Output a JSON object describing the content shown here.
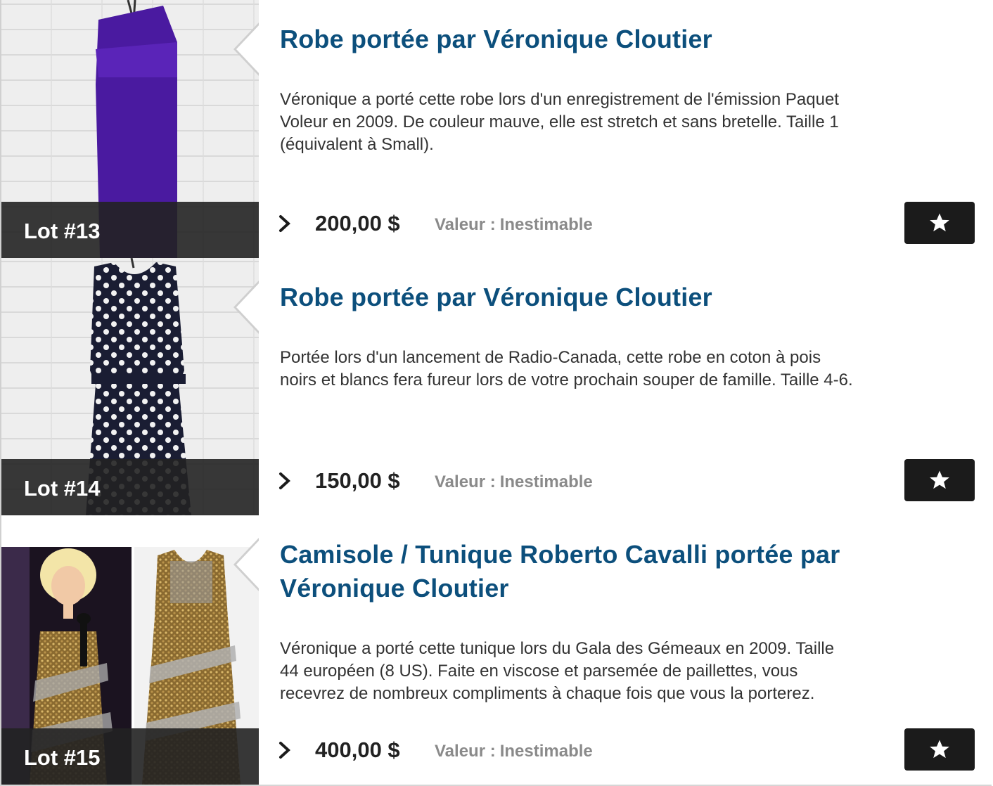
{
  "currency_note": "",
  "lots": [
    {
      "lot_label": "Lot #13",
      "title": "Robe portée par Véronique Cloutier",
      "description": "Véronique a porté cette robe lors d'un enregistrement de l'émission Paquet Voleur en 2009. De couleur mauve, elle est stretch et sans bretelle. Taille 1 (équivalent à Small).",
      "price": "200,00 $",
      "value_label": "Valeur :",
      "value_text": "Inestimable",
      "image_icon": "purple-dress-photo"
    },
    {
      "lot_label": "Lot #14",
      "title": "Robe portée par Véronique Cloutier",
      "description": "Portée lors d'un lancement de Radio-Canada, cette robe en coton à pois noirs et blancs fera fureur lors de votre prochain souper de famille. Taille 4-6.",
      "price": "150,00 $",
      "value_label": "Valeur :",
      "value_text": "Inestimable",
      "image_icon": "polka-dot-dress-photo"
    },
    {
      "lot_label": "Lot #15",
      "title": "Camisole / Tunique Roberto Cavalli portée par Véronique Cloutier",
      "description": "Véronique a porté cette tunique lors du Gala des Gémeaux en 2009. Taille 44 européen (8 US). Faite en viscose et parsemée de paillettes, vous recevrez de nombreux compliments à chaque fois que vous la porterez.",
      "price": "400,00 $",
      "value_label": "Valeur :",
      "value_text": "Inestimable",
      "image_icon": "sequin-tunic-photo"
    }
  ],
  "colors": {
    "title": "#0c4f7c",
    "badge_bg": "#222222",
    "fav_bg": "#1b1b1b",
    "value_grey": "#8a8a8a"
  }
}
